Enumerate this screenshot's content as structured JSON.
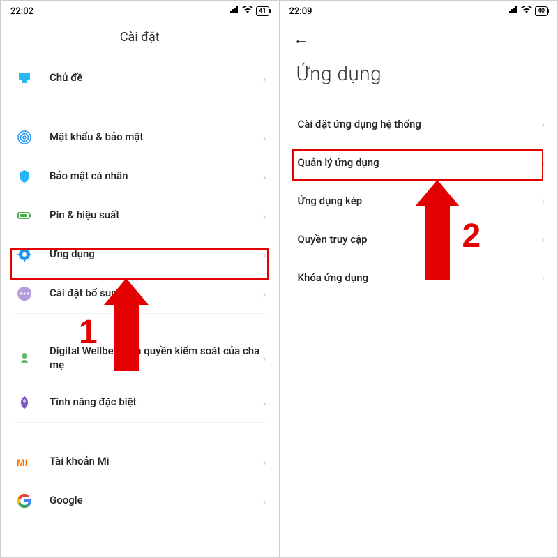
{
  "left": {
    "status": {
      "time": "22:02",
      "battery": "41"
    },
    "title": "Cài đặt",
    "groups": [
      [
        {
          "icon": "theme",
          "label": "Chủ đề"
        }
      ],
      [
        {
          "icon": "fingerprint",
          "label": "Mật khẩu & bảo mật"
        },
        {
          "icon": "shield",
          "label": "Bảo mật cá nhân"
        },
        {
          "icon": "battery",
          "label": "Pin & hiệu suất"
        },
        {
          "icon": "apps",
          "label": "Ứng dụng"
        },
        {
          "icon": "more",
          "label": "Cài đặt bổ sung"
        }
      ],
      [
        {
          "icon": "wellbeing",
          "label": "Digital Wellbeing và quyền kiểm soát của cha mẹ"
        },
        {
          "icon": "special",
          "label": "Tính năng đặc biệt"
        }
      ],
      [
        {
          "icon": "mi",
          "label": "Tài khoản Mi"
        },
        {
          "icon": "google",
          "label": "Google"
        }
      ]
    ]
  },
  "right": {
    "status": {
      "time": "22:09",
      "battery": "40"
    },
    "title": "Ứng dụng",
    "items": [
      {
        "label": "Cài đặt ứng dụng hệ thống"
      },
      {
        "label": "Quản lý ứng dụng"
      },
      {
        "label": "Ứng dụng kép"
      },
      {
        "label": "Quyền truy cập"
      },
      {
        "label": "Khóa ứng dụng"
      }
    ]
  },
  "annotations": {
    "step1": "1",
    "step2": "2"
  }
}
